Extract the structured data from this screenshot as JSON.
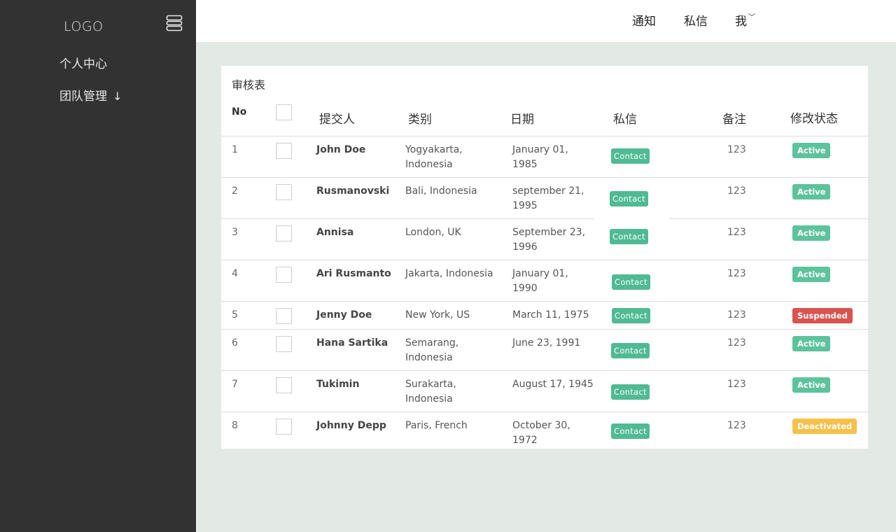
{
  "sidebar": {
    "logo": "LOGO",
    "items": [
      {
        "label": "个人中心"
      },
      {
        "label": "团队管理",
        "arrow": "↓"
      }
    ]
  },
  "topbar": {
    "notifications": "通知",
    "messages": "私信",
    "me": "我",
    "me_caret": "﹀"
  },
  "table": {
    "title": "审核表",
    "headers": {
      "no": "No",
      "submitter": "提交人",
      "category": "类别",
      "date": "日期",
      "message": "私信",
      "note": "备注",
      "status": "修改状态"
    },
    "contact_label": "Contact",
    "rows": [
      {
        "no": "1",
        "name": "John Doe",
        "category": [
          "Yogyakarta,",
          "Indonesia"
        ],
        "date": [
          "January 01,",
          "1985"
        ],
        "note": "123",
        "status": "Active"
      },
      {
        "no": "2",
        "name": "Rusmanovski",
        "category": [
          "Bali, Indonesia"
        ],
        "date": [
          "september 21,",
          "1995"
        ],
        "note": "123",
        "status": "Active"
      },
      {
        "no": "3",
        "name": "Annisa",
        "category": [
          "London, UK"
        ],
        "date": [
          "September 23,",
          "1996"
        ],
        "note": "123",
        "status": "Active"
      },
      {
        "no": "4",
        "name": "Ari Rusmanto",
        "category": [
          "Jakarta, Indonesia"
        ],
        "date": [
          "January 01,",
          "1990"
        ],
        "note": "123",
        "status": "Active"
      },
      {
        "no": "5",
        "name": "Jenny Doe",
        "category": [
          "New York, US"
        ],
        "date": [
          "March 11, 1975"
        ],
        "note": "123",
        "status": "Suspended"
      },
      {
        "no": "6",
        "name": "Hana Sartika",
        "category": [
          "Semarang,",
          "Indonesia"
        ],
        "date": [
          "June 23, 1991"
        ],
        "note": "123",
        "status": "Active"
      },
      {
        "no": "7",
        "name": "Tukimin",
        "category": [
          "Surakarta,",
          "Indonesia"
        ],
        "date": [
          "August 17, 1945"
        ],
        "note": "123",
        "status": "Active"
      },
      {
        "no": "8",
        "name": "Johnny Depp",
        "category": [
          "Paris, French"
        ],
        "date": [
          "October 30,",
          "1972"
        ],
        "note": "123",
        "status": "Deactivated"
      }
    ]
  },
  "colors": {
    "sidebar_bg": "#323232",
    "page_bg": "#e3e9e5",
    "contact_green": "#4fba93",
    "active_green": "#5dc39c",
    "suspended_red": "#d9534f",
    "deactivated_orange": "#f7c04a"
  }
}
